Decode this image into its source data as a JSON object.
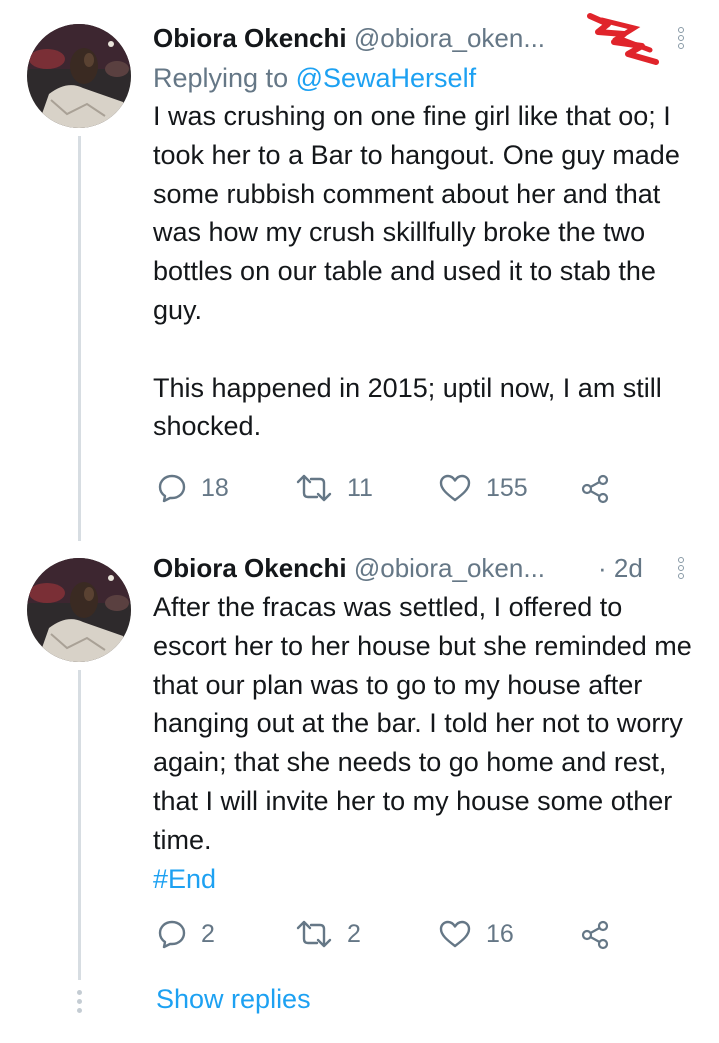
{
  "tweets": [
    {
      "name": "Obiora Okenchi",
      "handle": "@obiora_oken...",
      "time": "",
      "replying_label": "Replying to ",
      "replying_to": "@SewaHerself",
      "text": "I was crushing on one fine girl like that oo; I took her to a Bar to hangout. One guy made some rubbish comment about her and that was how my crush skillfully broke the two bottles on our table and used it to stab the guy.\n\nThis happened in 2015; uptil now, I am still shocked.",
      "hashtag": "",
      "replies": "18",
      "retweets": "11",
      "likes": "155"
    },
    {
      "name": "Obiora Okenchi",
      "handle": "@obiora_oken...",
      "time": "· 2d",
      "text": "After the fracas was settled, I offered to escort her to her house but she reminded me that our plan was to go to my house after hanging out at the bar. I told her not to worry again; that she needs to go home and rest, that I will invite her to my house some other time.",
      "hashtag": "#End",
      "replies": "2",
      "retweets": "2",
      "likes": "16"
    }
  ],
  "show_replies": "Show replies",
  "colors": {
    "link": "#1da1f2",
    "muted": "#657786",
    "text": "#14171a",
    "scribble": "#e0242b"
  },
  "icons": [
    "reply-icon",
    "retweet-icon",
    "like-icon",
    "share-icon",
    "more-icon"
  ]
}
